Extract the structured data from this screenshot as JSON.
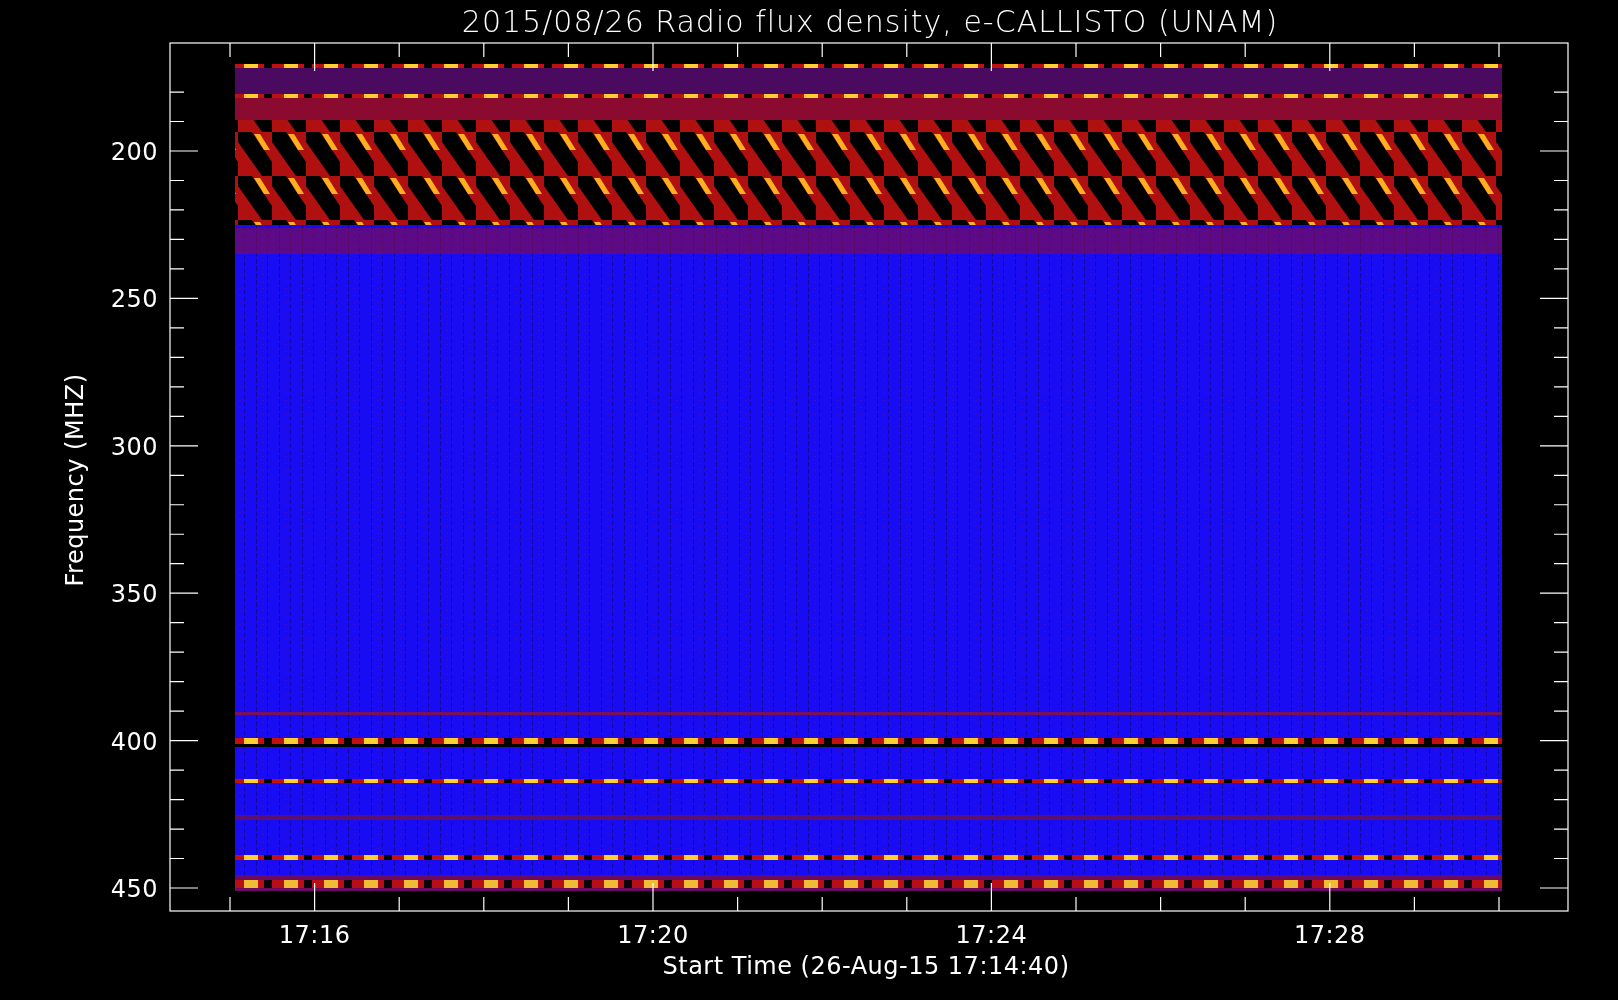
{
  "title": "2015/08/26  Radio flux density, e-CALLISTO (UNAM)",
  "plot": {
    "ylabel": "Frequency (MHZ)",
    "xlabel": "Start Time (26-Aug-15 17:14:40)",
    "yticks": [
      "200",
      "250",
      "300",
      "350",
      "400",
      "450"
    ],
    "xticks": [
      "17:16",
      "17:20",
      "17:24",
      "17:28"
    ]
  }
}
